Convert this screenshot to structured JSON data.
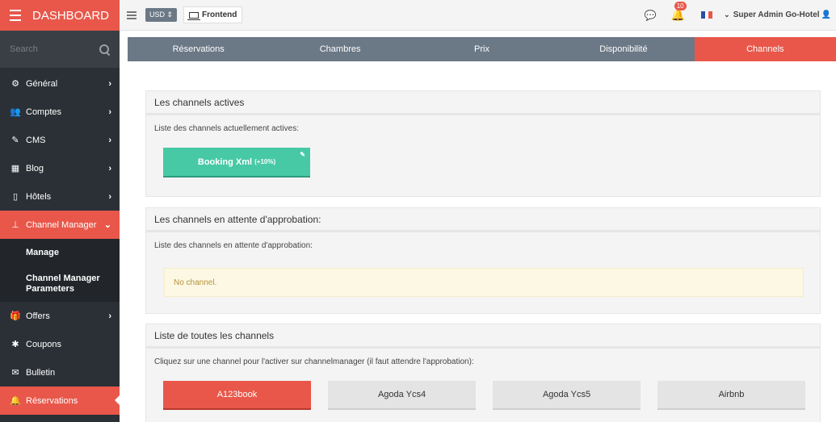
{
  "sidebar": {
    "title": "DASHBOARD",
    "search_placeholder": "Search",
    "items": [
      {
        "label": "Général",
        "icon": "gears-icon"
      },
      {
        "label": "Comptes",
        "icon": "users-icon"
      },
      {
        "label": "CMS",
        "icon": "wand-icon"
      },
      {
        "label": "Blog",
        "icon": "grid-icon"
      },
      {
        "label": "Hôtels",
        "icon": "tablet-icon"
      },
      {
        "label": "Channel Manager",
        "icon": "sitemap-icon"
      },
      {
        "label": "Offers",
        "icon": "gift-icon"
      },
      {
        "label": "Coupons",
        "icon": "asterisk-icon"
      },
      {
        "label": "Bulletin",
        "icon": "envelope-icon"
      },
      {
        "label": "Réservations",
        "icon": "bell-icon"
      }
    ],
    "submenu": [
      "Manage",
      "Channel Manager Parameters"
    ]
  },
  "topbar": {
    "currency": "USD ⇕",
    "frontend": "Frontend",
    "notif_count": "10",
    "user": "Super Admin Go-Hotel"
  },
  "tabs": [
    "Réservations",
    "Chambres",
    "Prix",
    "Disponibilité",
    "Channels"
  ],
  "active_panel": {
    "title": "Les channels actives",
    "desc": "Liste des channels actuellement actives:",
    "channel": "Booking Xml",
    "channel_note": "(+10%)"
  },
  "pending_panel": {
    "title": "Les channels en attente d'approbation:",
    "desc": "Liste des channels en attente d'approbation:",
    "empty": "No channel."
  },
  "all_panel": {
    "title": "Liste de toutes les channels",
    "desc": "Cliquez sur une channel pour l'activer sur channelmanager (il faut attendre l'approbation):",
    "channels": [
      "A123book",
      "Agoda Ycs4",
      "Agoda Ycs5",
      "Airbnb"
    ]
  },
  "colors": {
    "accent": "#e8574a",
    "sidebar": "#2b3036",
    "tabbar": "#6b7886",
    "booking": "#47c9a6"
  }
}
